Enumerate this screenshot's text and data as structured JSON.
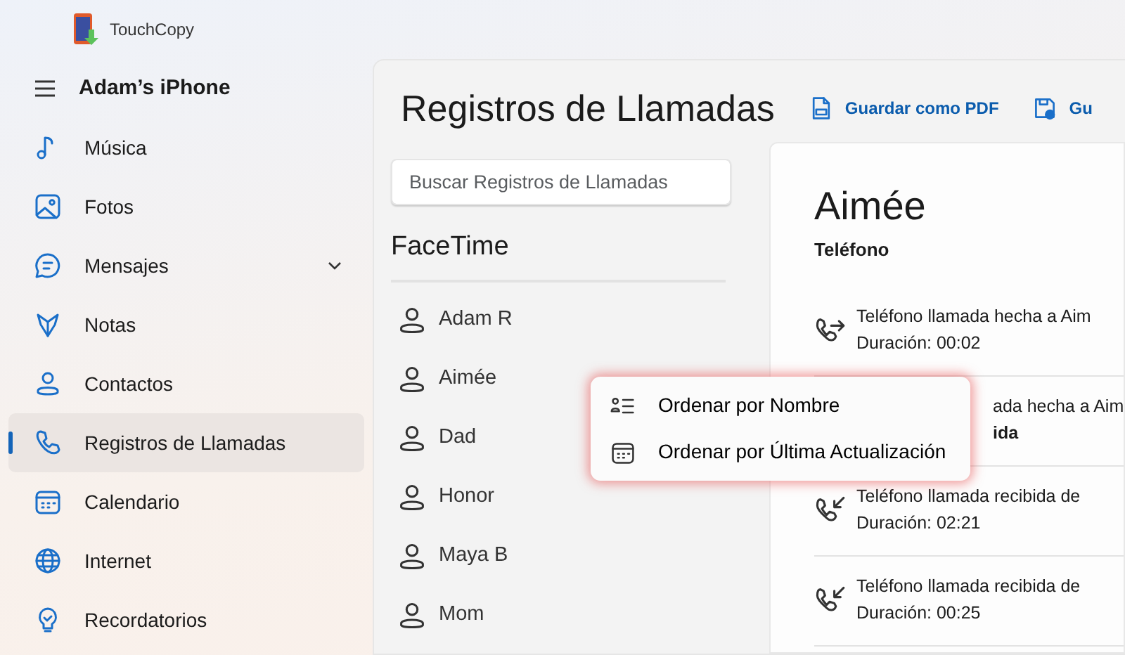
{
  "app": {
    "title": "TouchCopy"
  },
  "sidebar": {
    "device": "Adam’s iPhone",
    "items": [
      {
        "label": "Música",
        "selected": false
      },
      {
        "label": "Fotos",
        "selected": false
      },
      {
        "label": "Mensajes",
        "selected": false,
        "expandable": true
      },
      {
        "label": "Notas",
        "selected": false
      },
      {
        "label": "Contactos",
        "selected": false
      },
      {
        "label": "Registros de Llamadas",
        "selected": true
      },
      {
        "label": "Calendario",
        "selected": false
      },
      {
        "label": "Internet",
        "selected": false
      },
      {
        "label": "Recordatorios",
        "selected": false
      }
    ]
  },
  "page": {
    "title": "Registros de Llamadas",
    "actions": [
      {
        "label": "Guardar como PDF"
      },
      {
        "label": "Gu"
      }
    ]
  },
  "search": {
    "placeholder": "Buscar Registros de Llamadas"
  },
  "contacts": {
    "heading": "FaceTime",
    "items": [
      "Adam R",
      "Aimée",
      "Dad",
      "Honor",
      "Maya B",
      "Mom"
    ]
  },
  "detail": {
    "name": "Aimée",
    "subtitle": "Teléfono",
    "calls": [
      {
        "kind": "outgoing",
        "text": "Teléfono llamada hecha a Aim",
        "duration": "Duración: 00:02"
      },
      {
        "kind": "covered",
        "text": "ada hecha a Aim",
        "duration": "ida"
      },
      {
        "kind": "incoming",
        "text": "Teléfono llamada recibida de",
        "duration": "Duración: 02:21"
      },
      {
        "kind": "incoming",
        "text": "Teléfono llamada recibida de",
        "duration": "Duración: 00:25"
      }
    ]
  },
  "context_menu": {
    "items": [
      {
        "label": "Ordenar por Nombre"
      },
      {
        "label": "Ordenar por Última Actualización"
      }
    ]
  }
}
